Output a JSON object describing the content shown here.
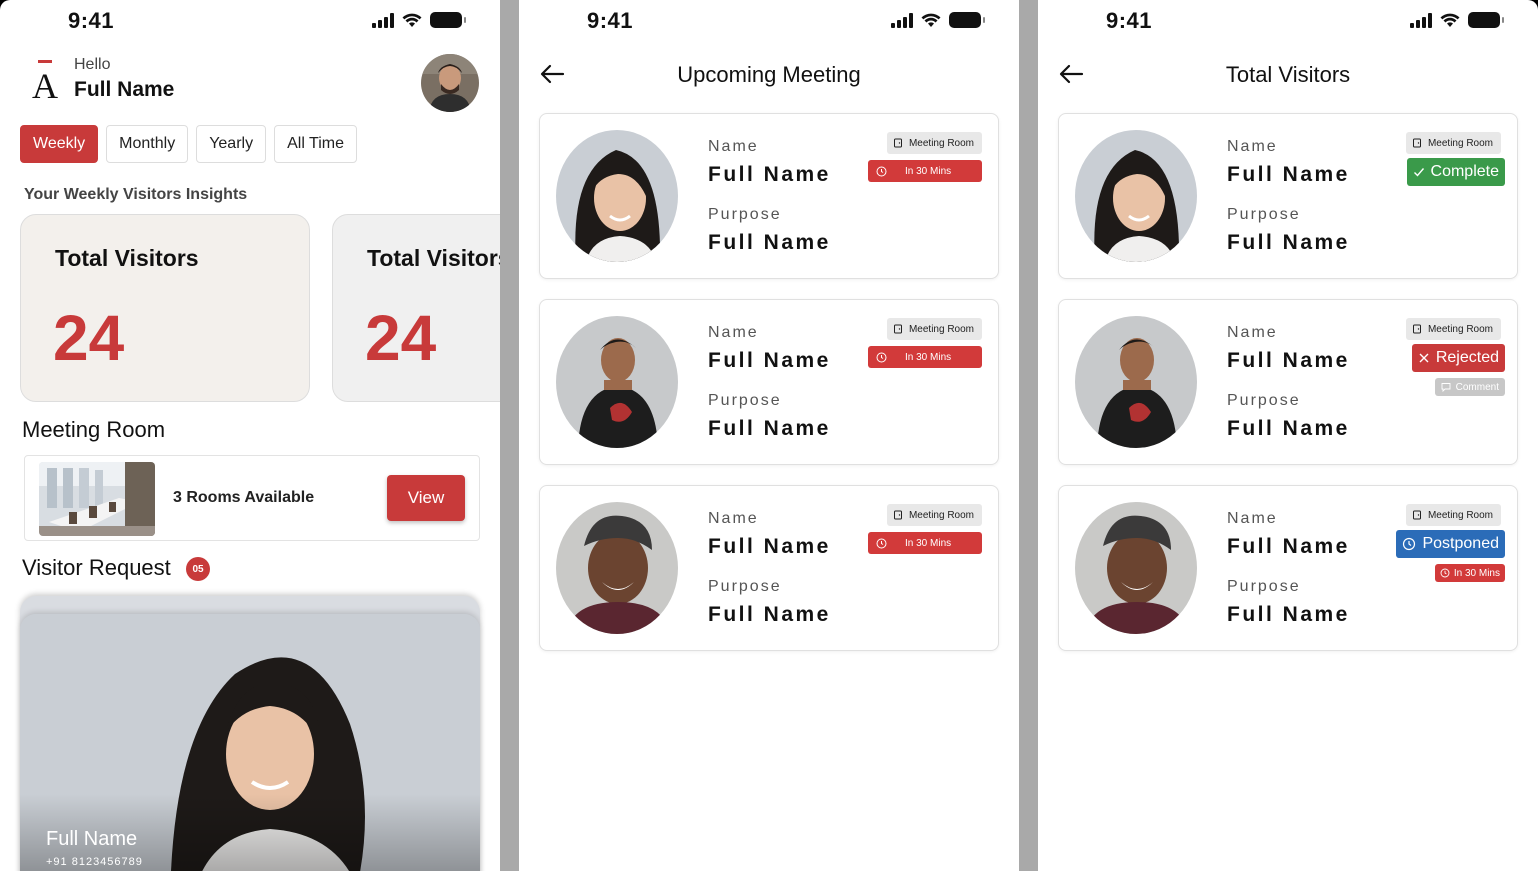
{
  "status_bar": {
    "time": "9:41"
  },
  "home": {
    "greeting": "Hello",
    "user_name": "Full Name",
    "tabs": [
      "Weekly",
      "Monthly",
      "Yearly",
      "All Time"
    ],
    "active_tab": "Weekly",
    "insights_title": "Your Weekly Visitors Insights",
    "stats": [
      {
        "label": "Total Visitors",
        "value": "24"
      },
      {
        "label": "Total Visitors",
        "value": "24"
      }
    ],
    "meeting_room": {
      "title": "Meeting Room",
      "availability": "3 Rooms Available",
      "view_label": "View"
    },
    "visitor_request": {
      "title": "Visitor Request",
      "count": "05",
      "name": "Full Name",
      "phone": "+91 8123456789"
    }
  },
  "upcoming": {
    "title": "Upcoming Meeting",
    "cards": [
      {
        "name_label": "Name",
        "name": "Full Name",
        "purpose_label": "Purpose",
        "purpose": "Full Name",
        "room": "Meeting Room",
        "time": "In 30 Mins"
      },
      {
        "name_label": "Name",
        "name": "Full Name",
        "purpose_label": "Purpose",
        "purpose": "Full Name",
        "room": "Meeting Room",
        "time": "In 30 Mins"
      },
      {
        "name_label": "Name",
        "name": "Full Name",
        "purpose_label": "Purpose",
        "purpose": "Full Name",
        "room": "Meeting Room",
        "time": "In 30 Mins"
      }
    ]
  },
  "visitors": {
    "title": "Total Visitors",
    "cards": [
      {
        "name_label": "Name",
        "name": "Full Name",
        "purpose_label": "Purpose",
        "purpose": "Full Name",
        "room": "Meeting Room",
        "status": "Complete"
      },
      {
        "name_label": "Name",
        "name": "Full Name",
        "purpose_label": "Purpose",
        "purpose": "Full Name",
        "room": "Meeting Room",
        "status": "Rejected",
        "comment": "Comment"
      },
      {
        "name_label": "Name",
        "name": "Full Name",
        "purpose_label": "Purpose",
        "purpose": "Full Name",
        "room": "Meeting Room",
        "status": "Postponed",
        "time": "In 30 Mins"
      }
    ]
  },
  "colors": {
    "accent": "#c83a3a",
    "complete": "#3a9a4a",
    "postponed": "#2b6cb8",
    "separator": "#a9a9a9"
  },
  "icons": [
    "signal-icon",
    "wifi-icon",
    "battery-icon",
    "back-arrow-icon",
    "door-icon",
    "clock-icon",
    "check-icon",
    "close-icon",
    "comment-icon",
    "postpone-clock-icon"
  ]
}
